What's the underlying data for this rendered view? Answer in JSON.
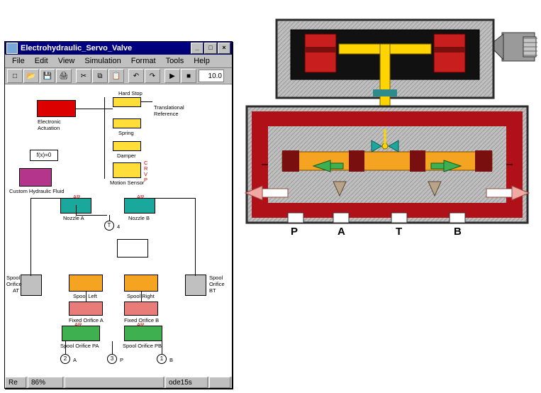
{
  "window": {
    "title": "Electrohydraulic_Servo_Valve",
    "min": "_",
    "max": "□",
    "close": "×"
  },
  "menu": {
    "file": "File",
    "edit": "Edit",
    "view": "View",
    "simulation": "Simulation",
    "format": "Format",
    "tools": "Tools",
    "help": "Help"
  },
  "toolbar": {
    "new": "□",
    "open": "📂",
    "save": "💾",
    "print": "🖨",
    "cut": "✂",
    "copy": "⧉",
    "paste": "📋",
    "undo": "↶",
    "redo": "↷",
    "start": "▶",
    "stop": "■",
    "stop_time": "10.0"
  },
  "blocks": {
    "electronic_actuation": "Electronic\nActuation",
    "hard_stop": "Hard Stop",
    "spring": "Spring",
    "damper": "Damper",
    "trans_ref": "Translational\nReference",
    "motion_sensor": "Motion Sensor",
    "fx0": "f(x)=0",
    "custom_fluid": "Custom Hydraulic Fluid",
    "nozzle_a": "Nozzle A",
    "nozzle_b": "Nozzle B",
    "t_port": "T",
    "spool_orifice_at": "Spool\nOrifice\nAT",
    "spool_orifice_bt": "Spool\nOrifice\nBT",
    "spool_left": "Spool Left",
    "spool_right": "Spool Right",
    "fixed_orifice_a": "Fixed Orifice A",
    "fixed_orifice_b": "Fixed Orifice B",
    "spool_orifice_pa": "Spool Orifice PA",
    "spool_orifice_pb": "Spool Orifice PB",
    "port_a": "A",
    "port_p": "P",
    "port_b": "B",
    "pin_ar": "AR",
    "pin_r": "R",
    "pin_c": "C",
    "pin_v": "V",
    "pin_p": "P",
    "num2": "2",
    "num3": "3",
    "num4": "4",
    "num1": "1"
  },
  "status": {
    "ready": "Re",
    "progress": "86%",
    "solver": "ode15s"
  },
  "valve_ports": {
    "p": "P",
    "a": "A",
    "t": "T",
    "b": "B"
  }
}
